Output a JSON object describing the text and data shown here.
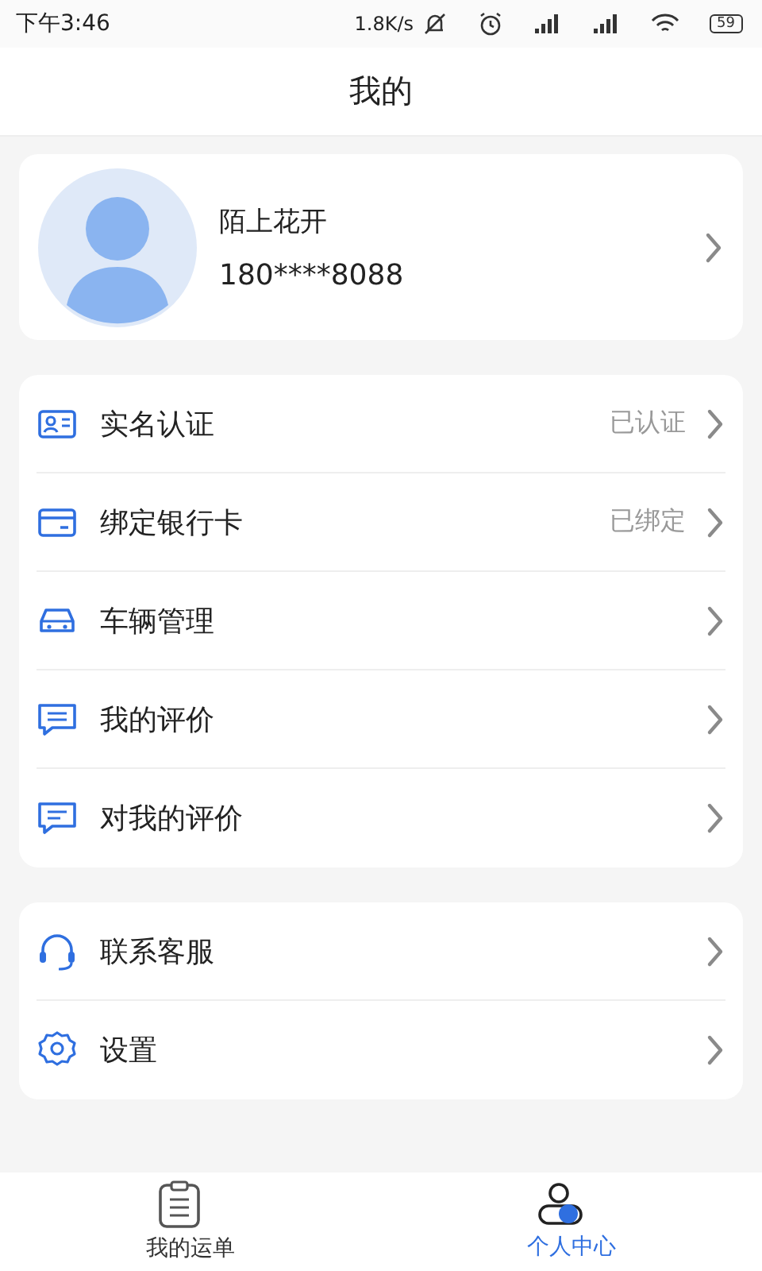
{
  "status_bar": {
    "time": "下午3:46",
    "speed": "1.8K/s",
    "battery": "59"
  },
  "header": {
    "title": "我的"
  },
  "profile": {
    "name": "陌上花开",
    "phone": "180****8088"
  },
  "menu_groups": [
    {
      "items": [
        {
          "label": "实名认证",
          "value": "已认证"
        },
        {
          "label": "绑定银行卡",
          "value": "已绑定"
        },
        {
          "label": "车辆管理"
        },
        {
          "label": "我的评价"
        },
        {
          "label": "对我的评价"
        }
      ]
    },
    {
      "items": [
        {
          "label": "联系客服"
        },
        {
          "label": "设置"
        }
      ]
    }
  ],
  "tabs": [
    {
      "label": "我的运单",
      "selected": false
    },
    {
      "label": "个人中心",
      "selected": true
    }
  ]
}
